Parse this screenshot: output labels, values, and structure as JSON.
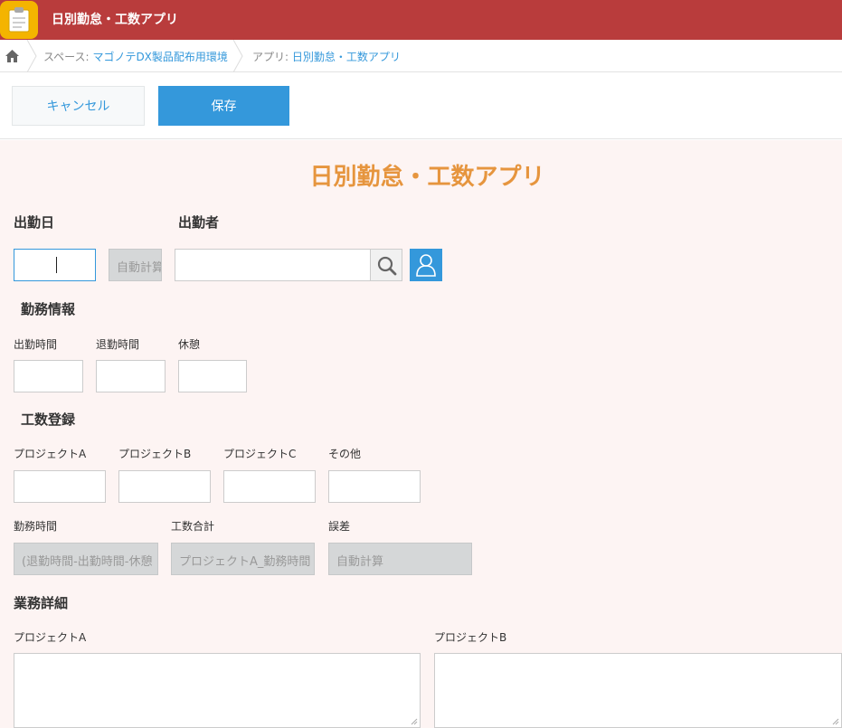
{
  "header": {
    "title": "日別勤怠・工数アプリ"
  },
  "breadcrumb": {
    "space_prefix": "スペース:",
    "space_name": "マゴノテDX製品配布用環境",
    "app_prefix": "アプリ:",
    "app_name": "日別勤怠・工数アプリ"
  },
  "toolbar": {
    "cancel_label": "キャンセル",
    "save_label": "保存"
  },
  "form": {
    "title": "日別勤怠・工数アプリ",
    "date_label": "出勤日",
    "date_value": "",
    "date_auto_value": "自動計算",
    "worker_label": "出勤者",
    "worker_value": "",
    "section_work": "勤務情報",
    "start_label": "出勤時間",
    "end_label": "退勤時間",
    "break_label": "休憩",
    "section_hours": "工数登録",
    "project_a_label": "プロジェクトA",
    "project_b_label": "プロジェクトB",
    "project_c_label": "プロジェクトC",
    "other_label": "その他",
    "work_hours_label": "勤務時間",
    "work_hours_value": "(退勤時間-出勤時間-休憩",
    "total_label": "工数合計",
    "total_value": "プロジェクトA_勤務時間",
    "diff_label": "誤差",
    "diff_value": "自動計算",
    "section_detail": "業務詳細",
    "detail_a_label": "プロジェクトA",
    "detail_b_label": "プロジェクトB"
  },
  "colors": {
    "header": "#b93c3c",
    "accent": "#3498db",
    "title": "#e6953e",
    "form_bg": "#fdf4f3"
  }
}
